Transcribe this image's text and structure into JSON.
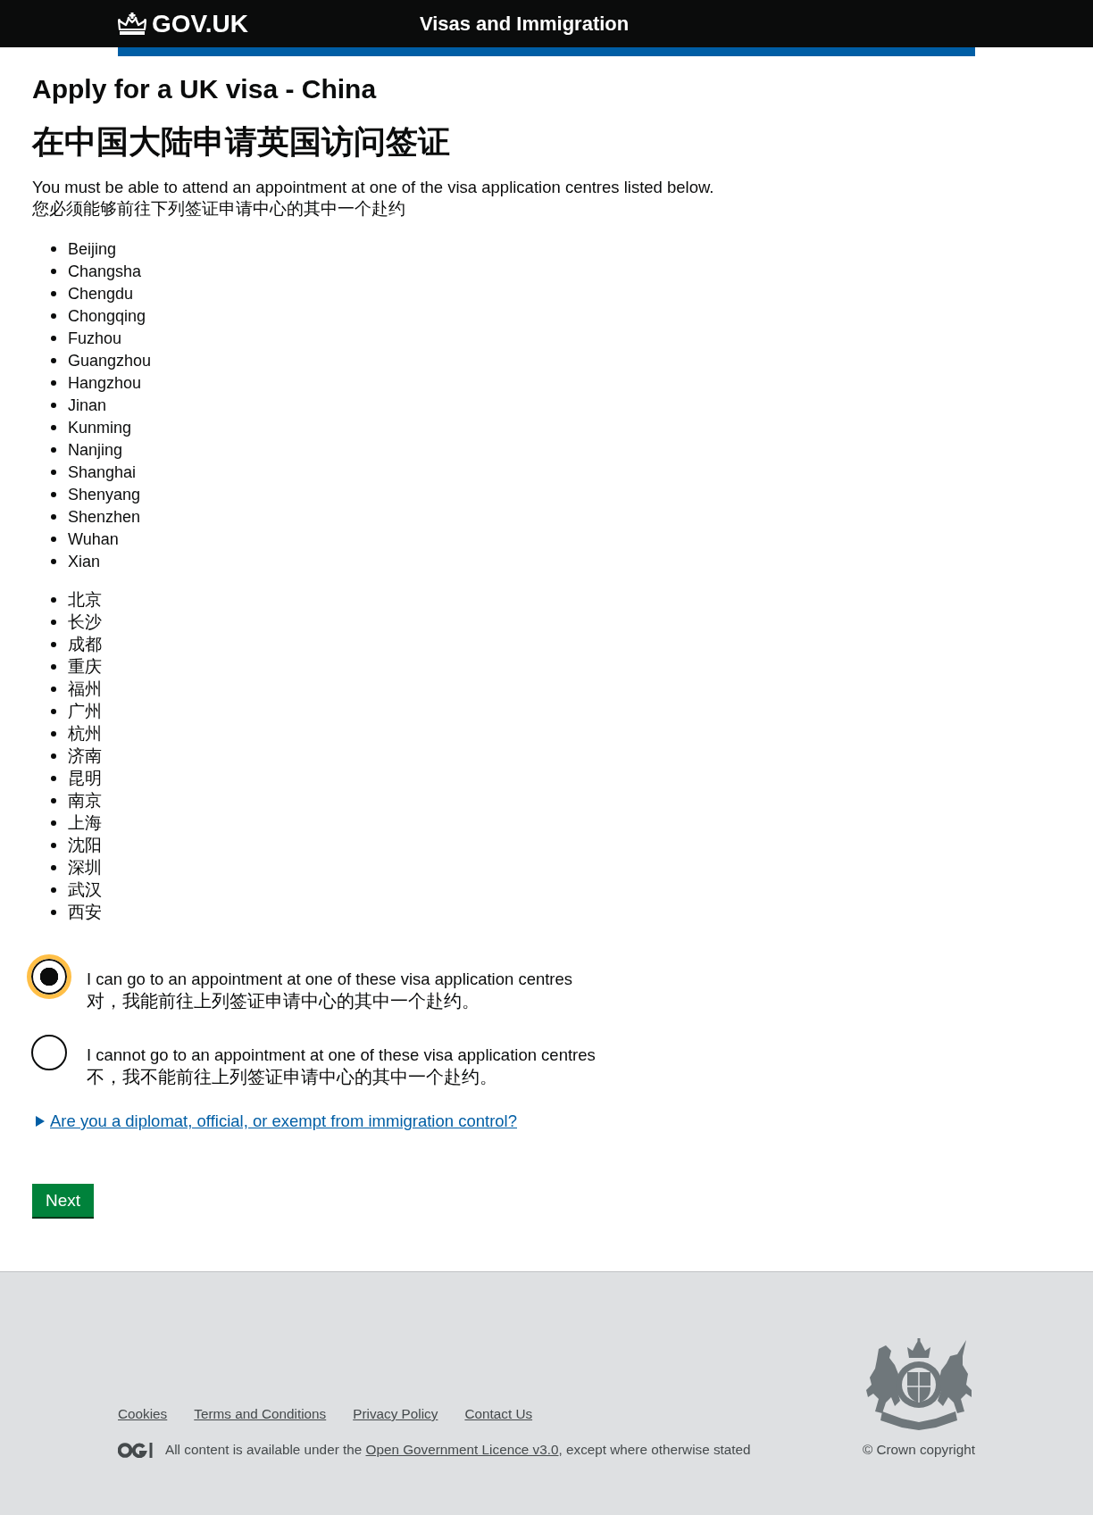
{
  "header": {
    "logo_text": "GOV.UK",
    "service_name": "Visas and Immigration"
  },
  "page": {
    "title": "Apply for a UK visa - China",
    "title_zh": "在中国大陆申请英国访问签证",
    "intro": "You must be able to attend an appointment at one of the visa application centres listed below.",
    "intro_zh": "您必须能够前往下列签证申请中心的其中一个赴约"
  },
  "centres": [
    "Beijing",
    "Changsha",
    "Chengdu",
    "Chongqing",
    "Fuzhou",
    "Guangzhou",
    "Hangzhou",
    "Jinan",
    "Kunming",
    "Nanjing",
    "Shanghai",
    "Shenyang",
    "Shenzhen",
    "Wuhan",
    "Xian"
  ],
  "centres_zh": [
    "北京",
    "长沙",
    "成都",
    "重庆",
    "福州",
    "广州",
    "杭州",
    "济南",
    "昆明",
    "南京",
    "上海",
    "沈阳",
    "深圳",
    "武汉",
    "西安"
  ],
  "options": [
    {
      "label": "I can go to an appointment at one of these visa application centres",
      "label_zh": "对，我能前往上列签证申请中心的其中一个赴约。",
      "selected": true,
      "focused": true
    },
    {
      "label": "I cannot go to an appointment at one of these visa application centres",
      "label_zh": "不，我不能前往上列签证申请中心的其中一个赴约。",
      "selected": false,
      "focused": false
    }
  ],
  "details": {
    "summary": "Are you a diplomat, official, or exempt from immigration control?",
    "expanded": false
  },
  "next_button": "Next",
  "footer": {
    "links": [
      "Cookies",
      "Terms and Conditions",
      "Privacy Policy",
      "Contact Us"
    ],
    "licence_before": "All content is available under the ",
    "licence_link": "Open Government Licence v3.0",
    "licence_after": ", except where otherwise stated",
    "copyright": "© Crown copyright"
  }
}
